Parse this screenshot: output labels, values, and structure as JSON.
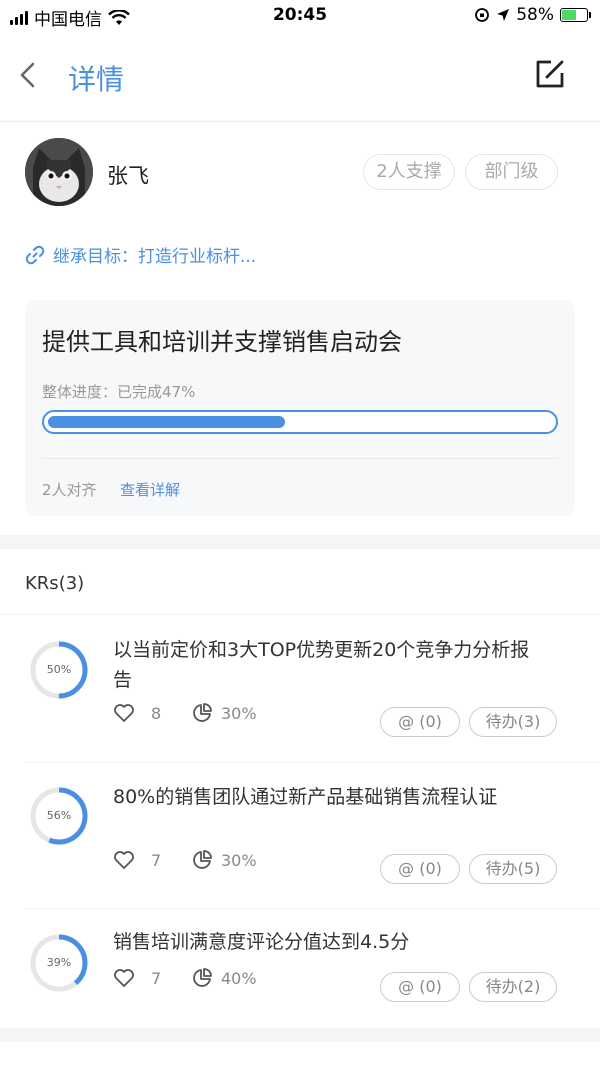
{
  "status_bar": {
    "carrier": "中国电信",
    "time": "20:45",
    "battery": "58%",
    "battery_level": 0.58
  },
  "nav": {
    "title": "详情"
  },
  "owner": {
    "name": "张飞",
    "tag_support": "2人支撑",
    "tag_level": "部门级"
  },
  "inherit": {
    "text": "继承目标：打造行业标杆..."
  },
  "goal": {
    "title": "提供工具和培训并支撑销售启动会",
    "progress_label": "整体进度：已完成47%",
    "progress": 0.47,
    "align_text": "2人对齐",
    "view_detail": "查看详解"
  },
  "krs": {
    "header": "KRs(3)",
    "items": [
      {
        "percent_label": "50%",
        "percent": 0.5,
        "title": "以当前定价和3大TOP优势更新20个竞争力分析报告",
        "likes": "8",
        "progress": "30%",
        "at_label": "@ (0)",
        "todo_label": "待办(3)"
      },
      {
        "percent_label": "56%",
        "percent": 0.56,
        "title": "80%的销售团队通过新产品基础销售流程认证",
        "likes": "7",
        "progress": "30%",
        "at_label": "@ (0)",
        "todo_label": "待办(5)"
      },
      {
        "percent_label": "39%",
        "percent": 0.39,
        "title": "销售培训满意度评论分值达到4.5分",
        "likes": "7",
        "progress": "40%",
        "at_label": "@ (0)",
        "todo_label": "待办(2)"
      }
    ]
  },
  "colors": {
    "accent": "#4a90e2",
    "ring_track": "#e6e6e6",
    "battery_green": "#4cd964"
  }
}
